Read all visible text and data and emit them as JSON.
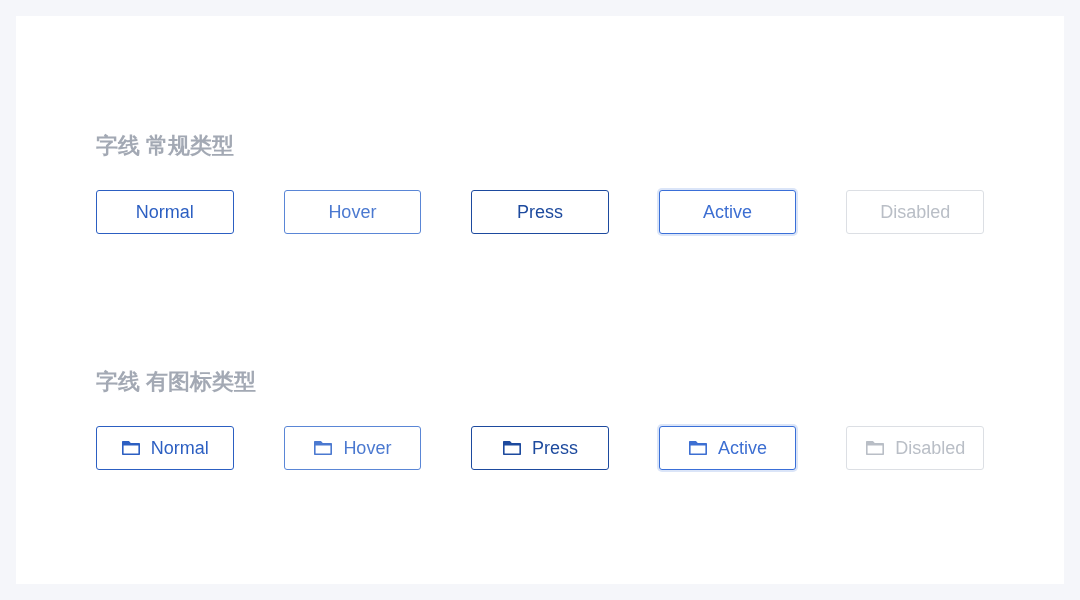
{
  "sections": [
    {
      "title": "字线 常规类型",
      "buttons": [
        {
          "label": "Normal",
          "hovered": false,
          "pressed": false,
          "active": false,
          "disabled": false
        },
        {
          "label": "Hover",
          "hovered": true,
          "pressed": false,
          "active": false,
          "disabled": false
        },
        {
          "label": "Press",
          "hovered": false,
          "pressed": true,
          "active": false,
          "disabled": false
        },
        {
          "label": "Active",
          "hovered": false,
          "pressed": false,
          "active": true,
          "disabled": false
        },
        {
          "label": "Disabled",
          "hovered": false,
          "pressed": false,
          "active": false,
          "disabled": true
        }
      ]
    },
    {
      "title": "字线 有图标类型",
      "buttons": [
        {
          "label": "Normal",
          "hovered": false,
          "pressed": false,
          "active": false,
          "disabled": false,
          "icon": true
        },
        {
          "label": "Hover",
          "hovered": true,
          "pressed": false,
          "active": false,
          "disabled": false,
          "icon": true
        },
        {
          "label": "Press",
          "hovered": false,
          "pressed": true,
          "active": false,
          "disabled": false,
          "icon": true
        },
        {
          "label": "Active",
          "hovered": false,
          "pressed": false,
          "active": true,
          "disabled": false,
          "icon": true
        },
        {
          "label": "Disabled",
          "hovered": false,
          "pressed": false,
          "active": false,
          "disabled": true,
          "icon": true
        }
      ]
    }
  ]
}
